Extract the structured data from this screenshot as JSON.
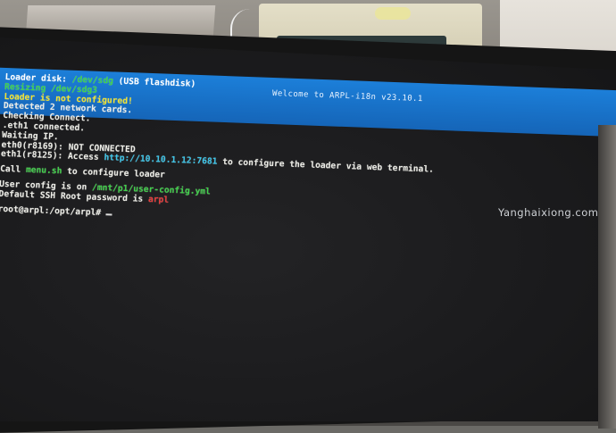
{
  "banner": {
    "title": "Welcome to ARPL-i18n v23.10.1"
  },
  "terminal": {
    "line1": {
      "label": "Loader disk: ",
      "device": "/dev/sdg",
      "note": " (USB flashdisk)"
    },
    "line2": {
      "label": "Resizing ",
      "device": "/dev/sdg3"
    },
    "line3": {
      "text": "Loader is not configured!"
    },
    "line4": {
      "text": "Detected 2 network cards."
    },
    "line5": {
      "text": "Checking Connect."
    },
    "line6": {
      "text": ".eth1 connected."
    },
    "line7": {
      "text": "Waiting IP."
    },
    "line8": {
      "text": "eth0(r8169): NOT CONNECTED"
    },
    "line9": {
      "label": "eth1(r8125): Access ",
      "url": "http://10.10.1.12:7681",
      "suffix": " to configure the loader via web terminal."
    },
    "line10": {
      "prefix": "Call ",
      "command": "menu.sh",
      "suffix": " to configure loader"
    },
    "line11": {
      "prefix": "User config is on ",
      "path": "/mnt/p1/user-config.yml"
    },
    "line12": {
      "prefix": "Default SSH Root password is ",
      "password": "arpl"
    },
    "prompt": "root@arpl:/opt/arpl# "
  },
  "watermark": "Yanghaixiong.com",
  "colors": {
    "banner": "#1c7fd9",
    "green": "#40d24a",
    "yellow": "#f2e32e",
    "cyan": "#3cc6ea",
    "red": "#ea3a3a"
  }
}
